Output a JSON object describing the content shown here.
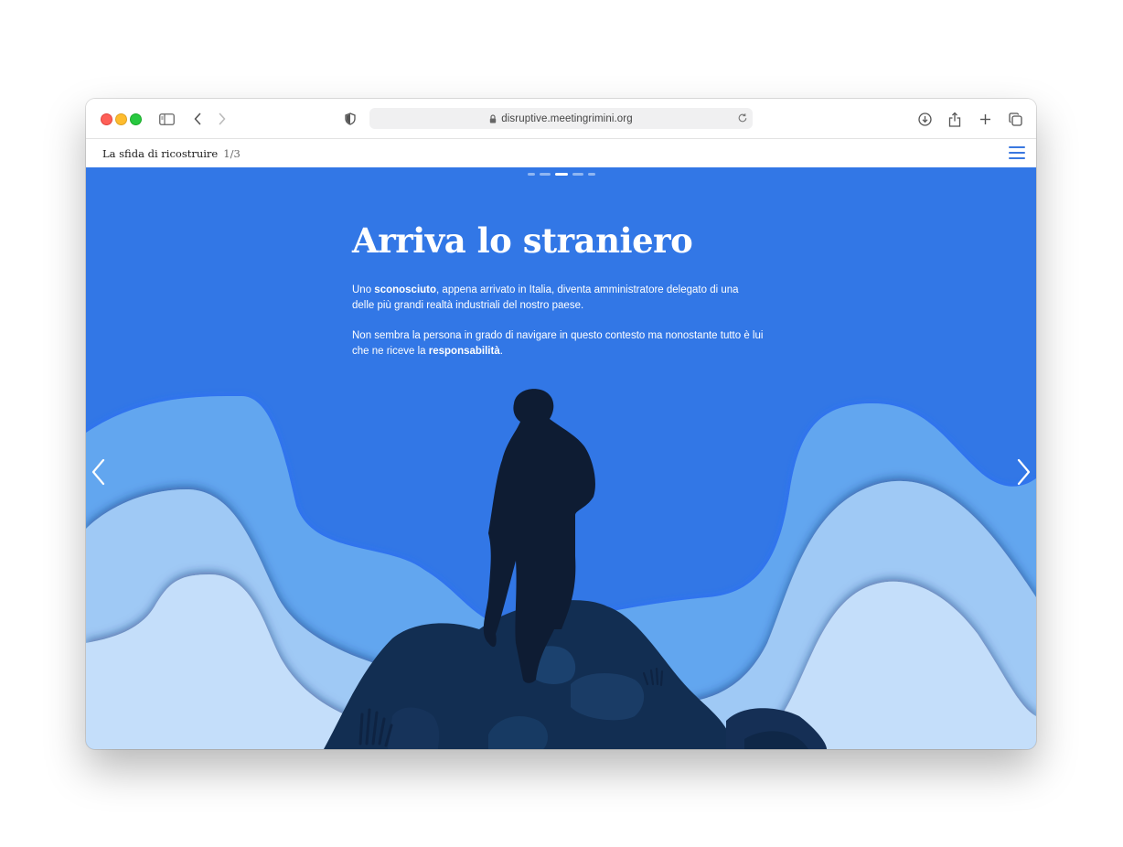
{
  "browser": {
    "url": "disruptive.meetingrimini.org",
    "icons": [
      "sidebar-icon",
      "back-icon",
      "forward-icon",
      "privacy-shield-icon",
      "lock-icon",
      "reload-icon",
      "download-icon",
      "share-icon",
      "new-tab-icon",
      "tabs-overview-icon"
    ]
  },
  "site": {
    "title": "La sfida di ricostruire",
    "page_count": "1/3",
    "menu_icon": "hamburger-menu-icon"
  },
  "slide": {
    "dots": [
      false,
      false,
      true,
      false,
      false
    ],
    "headline": "Arriva lo straniero",
    "p1_a": "Uno ",
    "p1_b": "sconosciuto",
    "p1_c": ", appena arrivato in Italia, diventa amministratore delegato di una delle più grandi realtà industriali del nostro paese.",
    "p2_a": "Non sembra la persona in grado di navigare in questo contesto ma nonostante tutto è lui che ne riceve la ",
    "p2_b": "responsabilità",
    "p2_c": ".",
    "illustration": "silhouette-man-on-rocks-illustration",
    "colors": {
      "sky": "#3277e6",
      "wave1": "#62a6ef",
      "wave2": "#9fc9f5",
      "wave3": "#c4defa",
      "figure": "#0e1c33",
      "rocks": "#122e52"
    }
  }
}
